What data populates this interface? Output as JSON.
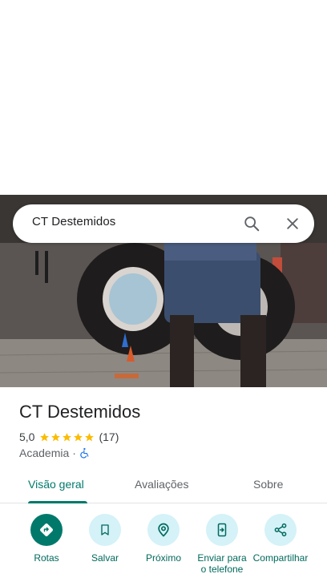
{
  "search": {
    "query": "CT Destemidos",
    "search_icon": "search-icon",
    "close_icon": "close-icon"
  },
  "place": {
    "name": "CT Destemidos",
    "rating": "5,0",
    "stars": 5,
    "review_count": "(17)",
    "category": "Academia",
    "separator": "·",
    "accessibility_icon": "wheelchair-icon"
  },
  "tabs": [
    {
      "label": "Visão geral",
      "active": true
    },
    {
      "label": "Avaliações",
      "active": false
    },
    {
      "label": "Sobre",
      "active": false
    }
  ],
  "actions": [
    {
      "label": "Rotas",
      "icon": "directions-icon"
    },
    {
      "label": "Salvar",
      "icon": "bookmark-icon"
    },
    {
      "label": "Próximo",
      "icon": "nearby-icon"
    },
    {
      "label": "Enviar para o telefone",
      "icon": "send-to-phone-icon"
    },
    {
      "label": "Compartilhar",
      "icon": "share-icon"
    }
  ],
  "colors": {
    "accent": "#00796b",
    "action_bg": "#d4f2f8",
    "star": "#fbbc04",
    "text_primary": "#202124"
  }
}
